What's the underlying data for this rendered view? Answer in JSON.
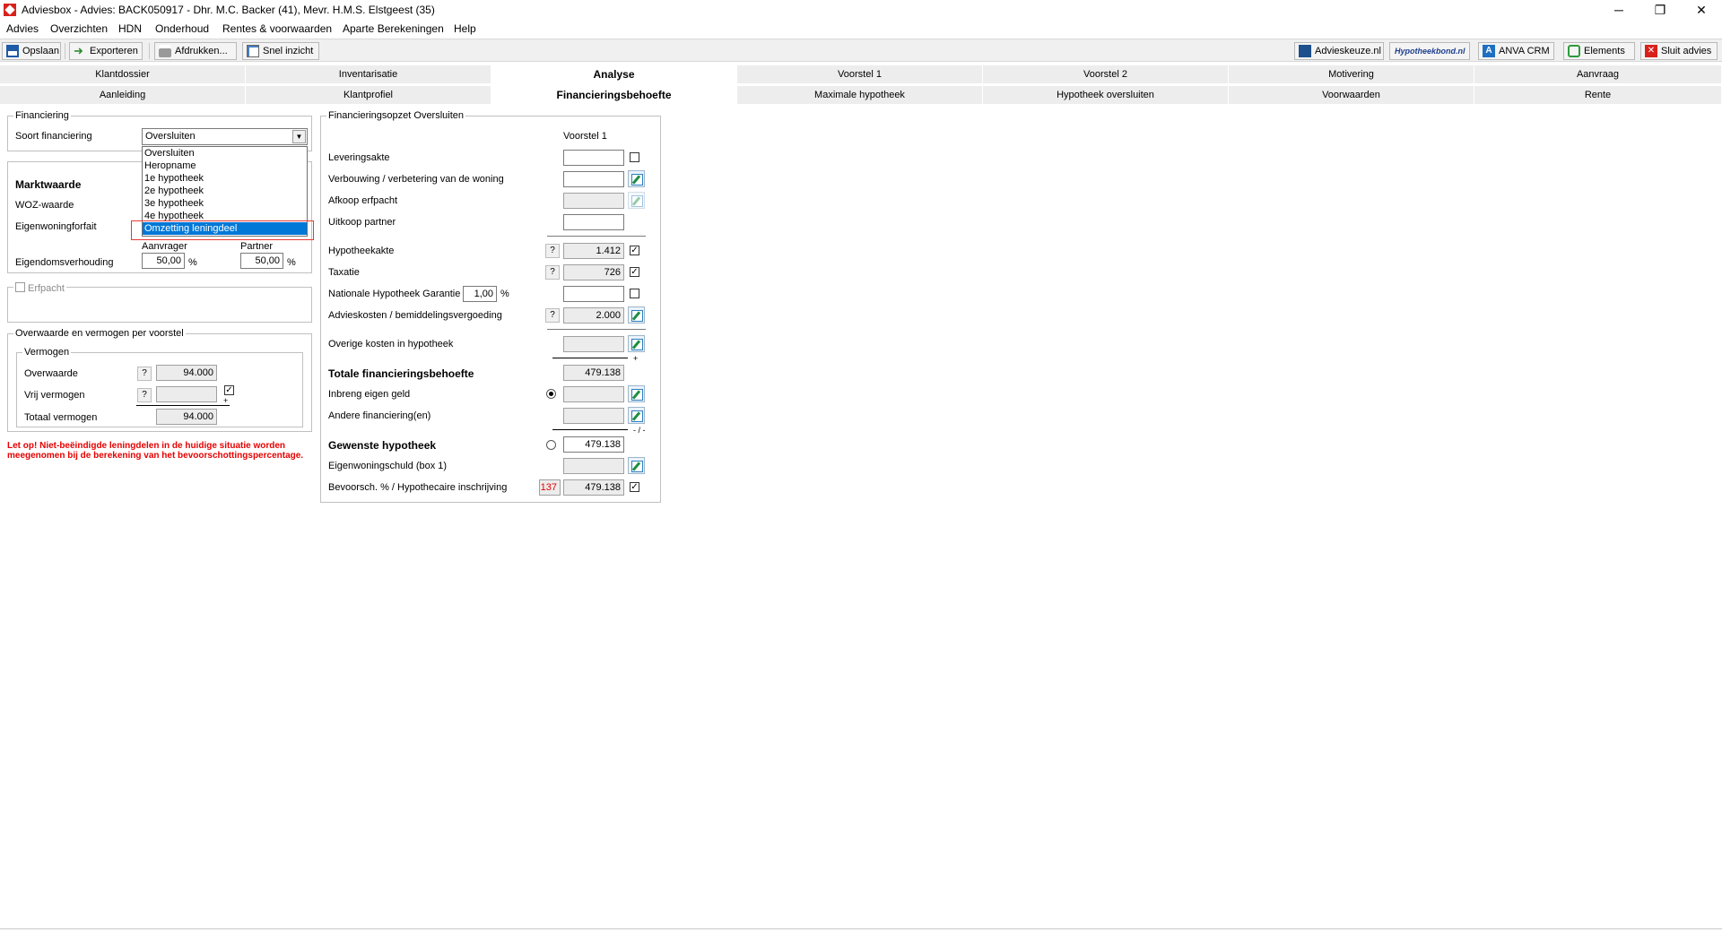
{
  "window": {
    "title": "Adviesbox - Advies: BACK050917 - Dhr. M.C. Backer (41), Mevr. H.M.S. Elstgeest (35)",
    "buttons": {
      "minimize": "─",
      "restore": "❐",
      "close": "✕"
    }
  },
  "menu": [
    "Advies",
    "Overzichten",
    "HDN",
    "Onderhoud",
    "Rentes & voorwaarden",
    "Aparte Berekeningen",
    "Help"
  ],
  "toolbar": {
    "save": "Opslaan",
    "export": "Exporteren",
    "print": "Afdrukken...",
    "quick_view": "Snel inzicht",
    "adviceskeuze": "Advieskeuze.nl",
    "hypotheekbond": "Hypotheekbond.nl",
    "anva": "ANVA CRM",
    "elements": "Elements",
    "close_advice": "Sluit advies"
  },
  "tabs_top": [
    "Klantdossier",
    "Inventarisatie",
    "Analyse",
    "Voorstel 1",
    "Voorstel 2",
    "Motivering",
    "Aanvraag"
  ],
  "tabs_bottom": [
    "Aanleiding",
    "Klantprofiel",
    "Financieringsbehoefte",
    "Maximale hypotheek",
    "Hypotheek oversluiten",
    "Voorwaarden",
    "Rente"
  ],
  "financiering": {
    "legend": "Financiering",
    "soort_label": "Soort financiering",
    "soort_value": "Oversluiten",
    "options": [
      "Oversluiten",
      "Heropname",
      "1e hypotheek",
      "2e hypotheek",
      "3e hypotheek",
      "4e hypotheek",
      "Omzetting leningdeel"
    ],
    "selected_option": "Omzetting leningdeel",
    "marktwaarde": "Marktwaarde",
    "woz": "WOZ-waarde",
    "eigenwoningforfait": "Eigenwoningforfait",
    "aanvrager": "Aanvrager",
    "partner": "Partner",
    "eigendomsverhouding": "Eigendomsverhouding",
    "aanvrager_pct": "50,00",
    "partner_pct": "50,00",
    "pct": "%"
  },
  "erfpacht": {
    "legend": "Erfpacht"
  },
  "overwaarde": {
    "legend": "Overwaarde en vermogen per voorstel",
    "vermogen_legend": "Vermogen",
    "overwaarde_label": "Overwaarde",
    "overwaarde_value": "94.000",
    "vrij_label": "Vrij vermogen",
    "totaal_label": "Totaal vermogen",
    "totaal_value": "94.000",
    "q": "?",
    "plus": "+"
  },
  "warning": {
    "line1": "Let op! Niet-beëindigde leningdelen in de huidige situatie worden",
    "line2": "meegenomen bij de berekening van het bevoorschottingspercentage."
  },
  "opzet": {
    "legend": "Financieringsopzet Oversluiten",
    "column": "Voorstel 1",
    "q": "?",
    "plus": "+",
    "minmin": "- / -",
    "rows": {
      "leveringsakte": "Leveringsakte",
      "verbouwing": "Verbouwing / verbetering van de woning",
      "afkoop": "Afkoop erfpacht",
      "uitkoop": "Uitkoop partner",
      "hypotheekakte": "Hypotheekakte",
      "hypotheekakte_value": "1.412",
      "taxatie": "Taxatie",
      "taxatie_value": "726",
      "nhg": "Nationale Hypotheek Garantie",
      "nhg_pct": "1,00",
      "pct": "%",
      "advieskosten": "Advieskosten / bemiddelingsvergoeding",
      "advieskosten_value": "2.000",
      "overige": "Overige kosten in hypotheek",
      "totaal": "Totale financieringsbehoefte",
      "totaal_value": "479.138",
      "inbreng": "Inbreng eigen geld",
      "andere": "Andere financiering(en)",
      "gewenste": "Gewenste hypotheek",
      "gewenste_value": "479.138",
      "eigenwoningschuld": "Eigenwoningschuld (box 1)",
      "bevoorsch": "Bevoorsch. % / Hypothecaire inschrijving",
      "bevoorsch_pct": "137",
      "bevoorsch_value": "479.138"
    }
  },
  "colors": {
    "accent": "#0078d7",
    "warning": "#e60000",
    "active_tab": "#ffffff",
    "tab": "#ededed"
  }
}
